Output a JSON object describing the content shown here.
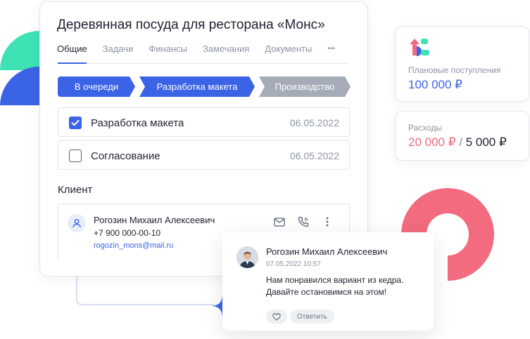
{
  "card": {
    "title": "Деревянная посуда для ресторана «Монс»",
    "tabs": [
      "Общие",
      "Задачи",
      "Финансы",
      "Замечания",
      "Документы",
      "•••"
    ],
    "active_tab": "Общие"
  },
  "stages": [
    {
      "label": "В очереди",
      "color": "#3b63e6"
    },
    {
      "label": "Разработка макета",
      "color": "#3b63e6"
    },
    {
      "label": "Производство",
      "color": "#a5abb7"
    }
  ],
  "tasks": [
    {
      "label": "Разработка макета",
      "date": "06.05.2022",
      "checked": true
    },
    {
      "label": "Согласование",
      "date": "06.05.2022",
      "checked": false
    }
  ],
  "client": {
    "section_title": "Клиент",
    "name": "Рогозин Михаил Алексеевич",
    "phone": "+7 900 000-00-10",
    "email": "rogozin_mons@mail.ru"
  },
  "income": {
    "label": "Плановые поступления",
    "value": "100 000 ₽",
    "color": "#3b63e6"
  },
  "expenses": {
    "label": "Расходы",
    "spent": "20 000 ₽",
    "separator": " / ",
    "total": "5 000 ₽",
    "spent_color": "#f26b7e"
  },
  "comment": {
    "author": "Рогозин Михаил Алексеевич",
    "time": "07.05.2022 10:57",
    "text": "Нам понравился вариант из кедра. Давайте остановимся на этом!",
    "reply_label": "Ответить"
  },
  "colors": {
    "accent": "#3b63e6",
    "green": "#3ee2b5",
    "pink": "#f26b7e",
    "gray_stage": "#a5abb7"
  }
}
